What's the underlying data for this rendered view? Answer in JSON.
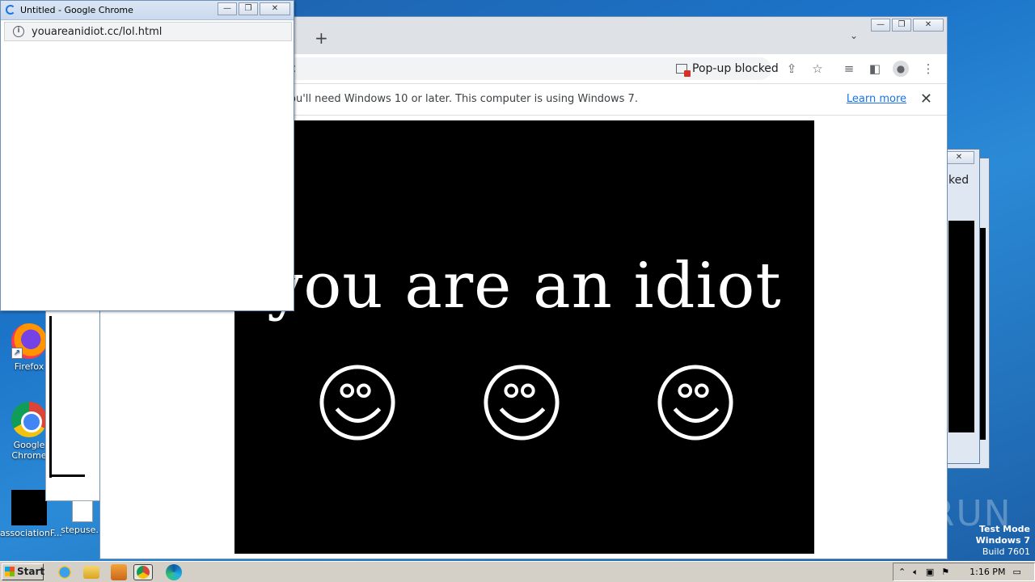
{
  "desktop": {
    "icons": [
      {
        "label": "Firefox"
      },
      {
        "label": "Google Chrome"
      },
      {
        "label": "associationF..."
      },
      {
        "label": "stepuse..."
      }
    ],
    "watermark": "ANY RUN",
    "test_mode": {
      "line1": "Test Mode",
      "line2": "Windows 7",
      "line3": "Build 7601"
    }
  },
  "chrome_main": {
    "omnibox_fragment": "c",
    "popup_blocked_label": "Pop-up blocked",
    "infobar": {
      "message": "ou'll need Windows 10 or later. This computer is using Windows 7.",
      "learn_more": "Learn more",
      "close_glyph": "✕"
    },
    "page": {
      "headline": "you are an idiot",
      "smileys": 3
    },
    "new_tab_glyph": "+"
  },
  "background_window": {
    "fragment": "ked"
  },
  "popup": {
    "title": "Untitled - Google Chrome",
    "url": "youareanidiot.cc/lol.html"
  },
  "taskbar": {
    "start_label": "Start",
    "clock": "1:16 PM",
    "apps": [
      "internet-explorer",
      "file-explorer",
      "media-player",
      "chrome",
      "edge"
    ]
  },
  "colors": {
    "accent": "#1a73e8",
    "page_bg": "#000000",
    "blocked_red": "#d93025"
  }
}
